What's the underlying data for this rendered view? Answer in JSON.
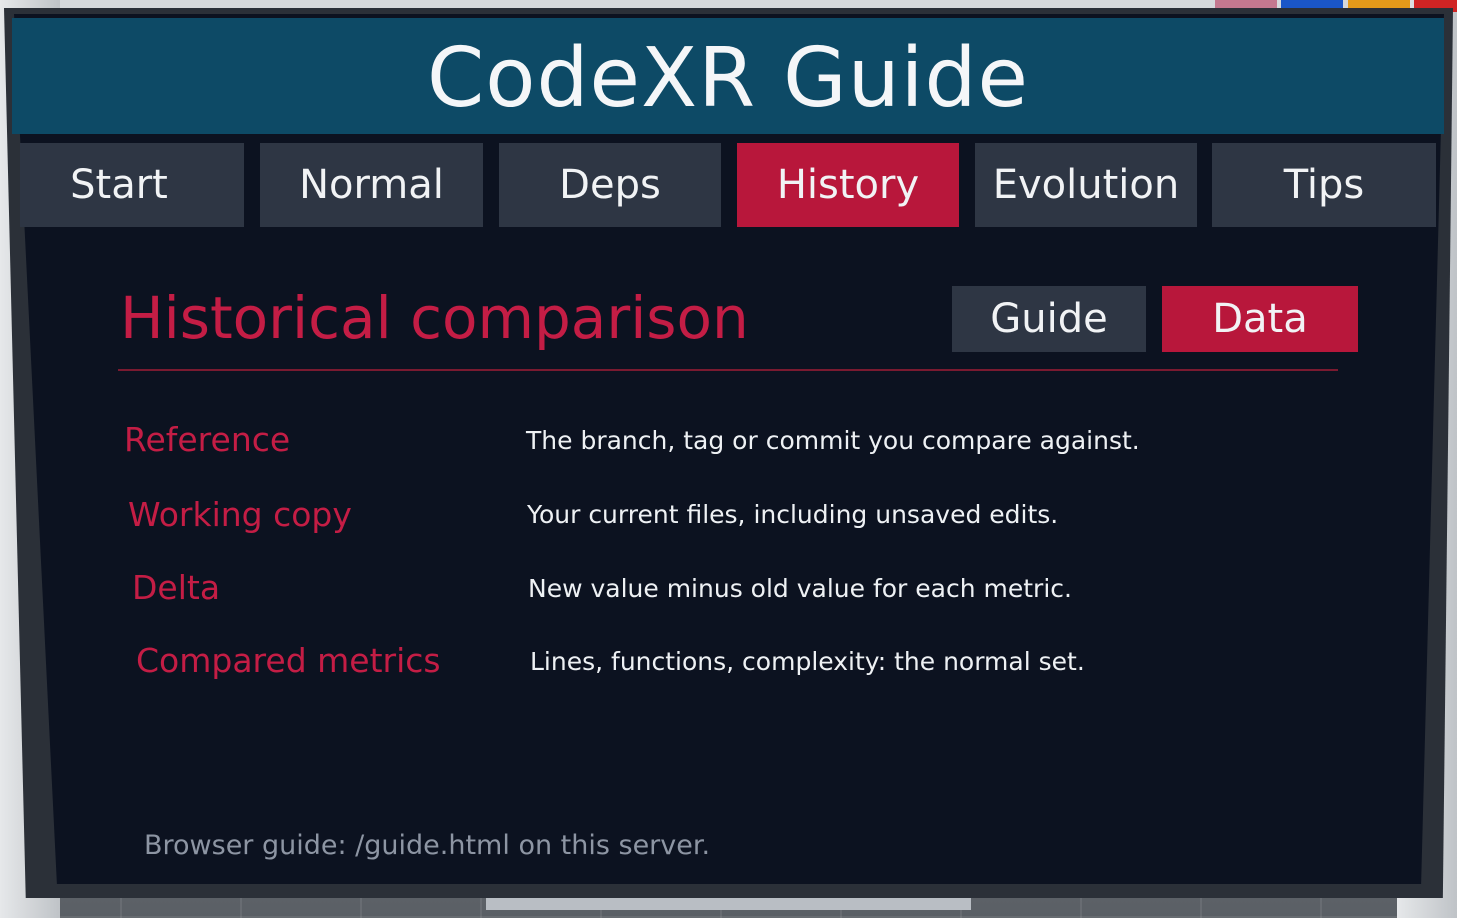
{
  "header": {
    "title": "CodeXR Guide"
  },
  "tabs": [
    {
      "label": "Start",
      "active": false
    },
    {
      "label": "Normal",
      "active": false
    },
    {
      "label": "Deps",
      "active": false
    },
    {
      "label": "History",
      "active": true
    },
    {
      "label": "Evolution",
      "active": false
    },
    {
      "label": "Tips",
      "active": false
    }
  ],
  "section": {
    "title": "Historical comparison",
    "toggle": {
      "guide_label": "Guide",
      "data_label": "Data",
      "selected": "Data"
    }
  },
  "definitions": [
    {
      "term": "Reference",
      "description": "The branch, tag or commit you compare against."
    },
    {
      "term": "Working copy",
      "description": "Your current files, including unsaved edits."
    },
    {
      "term": "Delta",
      "description": "New value minus old value for each metric."
    },
    {
      "term": "Compared metrics",
      "description": "Lines, functions, complexity: the normal set."
    }
  ],
  "footer": {
    "note": "Browser guide: /guide.html on this server."
  },
  "colors": {
    "header_bg": "#0d4a66",
    "accent": "#b8173b",
    "panel_bg": "#0c1220",
    "tab_bg": "#2e3644",
    "term_text": "#c41d45"
  }
}
